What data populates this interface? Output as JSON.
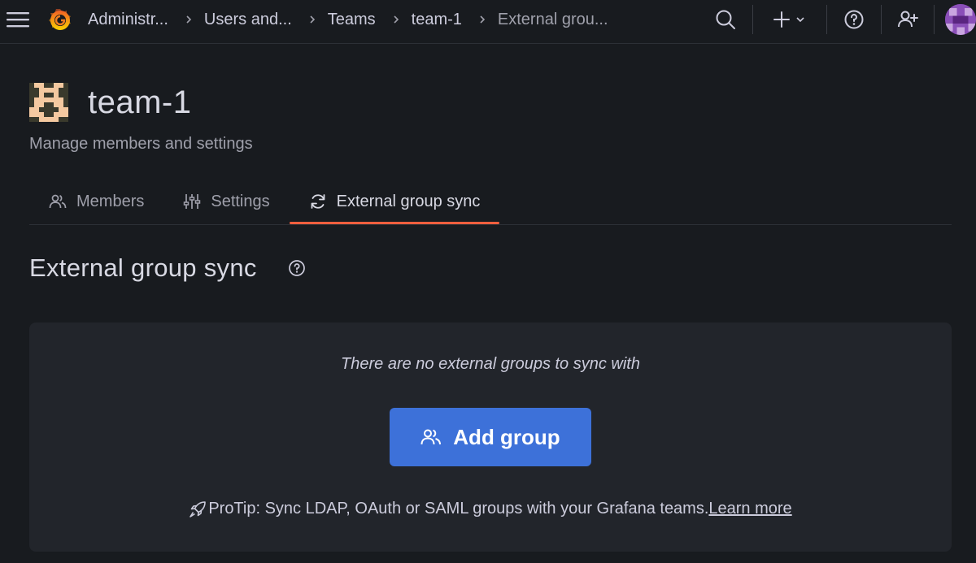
{
  "topbar": {
    "breadcrumbs": [
      "Administr...",
      "Users and...",
      "Teams",
      "team-1",
      "External grou..."
    ]
  },
  "team": {
    "name": "team-1",
    "subtitle": "Manage members and settings"
  },
  "tabs": [
    {
      "label": "Members",
      "icon": "users-icon"
    },
    {
      "label": "Settings",
      "icon": "sliders-icon"
    },
    {
      "label": "External group sync",
      "icon": "sync-icon",
      "active": true
    }
  ],
  "section": {
    "title": "External group sync"
  },
  "empty_state": {
    "message": "There are no external groups to sync with",
    "button_label": "Add group",
    "protip": "ProTip: Sync LDAP, OAuth or SAML groups with your Grafana teams.",
    "learn_more": "Learn more"
  },
  "colors": {
    "background": "#181b1f",
    "panel": "#22252b",
    "primary": "#3d71d9",
    "active_tab": "#f55f3e"
  }
}
